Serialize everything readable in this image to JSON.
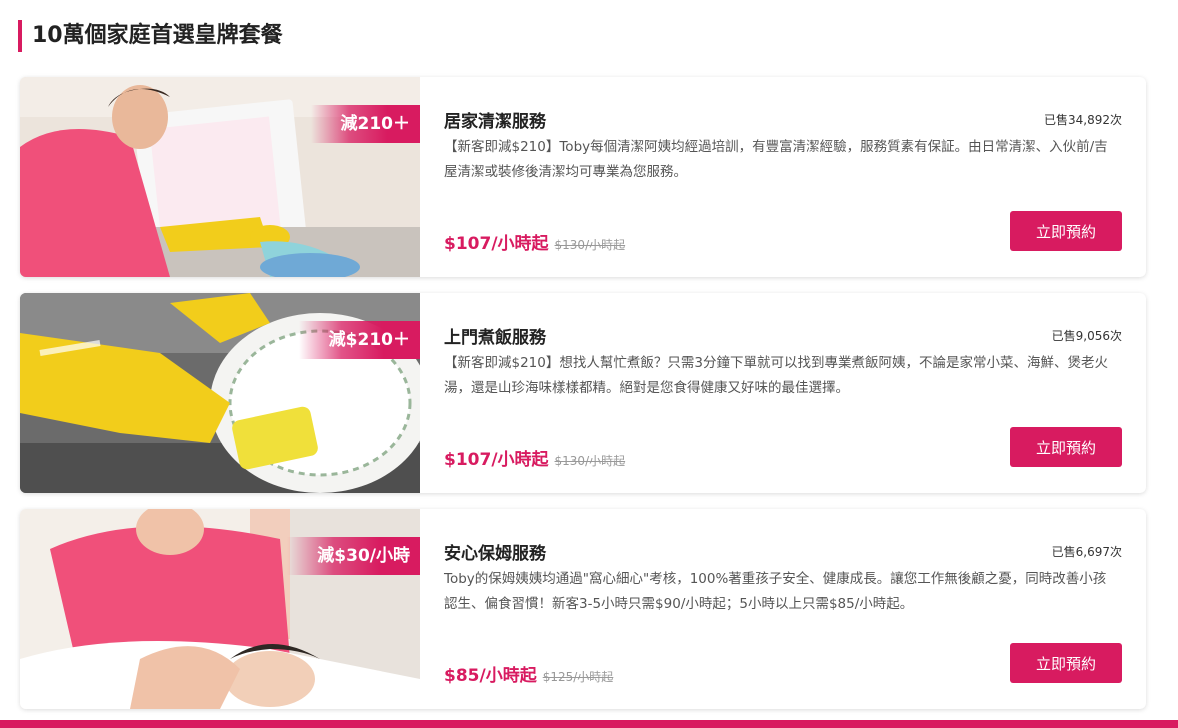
{
  "section": {
    "title": "10萬個家庭首選皇牌套餐"
  },
  "cards": [
    {
      "badge": "減210＋",
      "title": "居家清潔服務",
      "sold": "已售34,892次",
      "description": "【新客即減$210】Toby每個清潔阿姨均經過培訓，有豐富清潔經驗，服務質素有保証。由日常清潔、入伙前/吉屋清潔或裝修後清潔均可專業為您服務。",
      "price": "$107/小時起",
      "old_price": "$130/小時起",
      "button": "立即預約"
    },
    {
      "badge": "減$210＋",
      "title": "上門煮飯服務",
      "sold": "已售9,056次",
      "description": "【新客即減$210】想找人幫忙煮飯？只需3分鐘下單就可以找到專業煮飯阿姨，不論是家常小菜、海鮮、煲老火湯，還是山珍海味樣樣都精。絕對是您食得健康又好味的最佳選擇。",
      "price": "$107/小時起",
      "old_price": "$130/小時起",
      "button": "立即預約"
    },
    {
      "badge": "減$30/小時",
      "title": "安心保姆服務",
      "sold": "已售6,697次",
      "description": "Toby的保姆姨姨均通過\"窩心細心\"考核，100%著重孩子安全、健康成長。讓您工作無後顧之憂，同時改善小孩認生、偏食習慣！新客3-5小時只需$90/小時起；5小時以上只需$85/小時起。",
      "price": "$85/小時起",
      "old_price": "$125/小時起",
      "button": "立即預約"
    }
  ],
  "colors": {
    "accent": "#d81b60",
    "glove": "#f2cd1b",
    "shirt": "#f0507a"
  }
}
